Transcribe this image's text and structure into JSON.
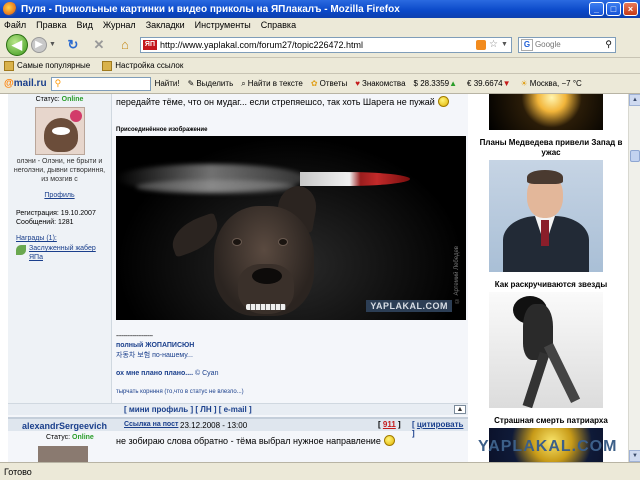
{
  "window": {
    "title": "Пуля - Прикольные картинки и видео приколы на ЯПлакалъ - Mozilla Firefox",
    "minimize": "_",
    "maximize": "□",
    "close": "×"
  },
  "menu": [
    "Файл",
    "Правка",
    "Вид",
    "Журнал",
    "Закладки",
    "Инструменты",
    "Справка"
  ],
  "nav": {
    "url": "http://www.yaplakal.com/forum27/topic226472.html",
    "site_icon_text": "ЯП",
    "search_placeholder": "Google",
    "search_engine_letter": "G"
  },
  "bookmarks": [
    "Самые популярные",
    "Настройка ссылок"
  ],
  "mailbar": {
    "logo_prefix": "@",
    "logo": "mail.ru",
    "find": "Найти!",
    "highlight": "Выделить",
    "find_in_text": "Найти в тексте",
    "answers": "Ответы",
    "dating": "Знакомства",
    "usd": "$ 28.3359",
    "eur": "€ 39.6674",
    "weather": "Москва, −7 °C"
  },
  "post1": {
    "user_status_label": "Статус:",
    "user_status_value": "Online",
    "motto": "олэни - Олэни, не брыти и неголэни, дывни створиння, из мозгив с",
    "profile_link": "Профиль",
    "registered": "Регистрация: 19.10.2007",
    "messages": "Сообщений: 1281",
    "awards_label": "Награды (1):",
    "award_name": "Заслуженный жабер ЯПа",
    "text": "передайте тёме, что он мудаг... если стрепяешсо, так хоть Шарега не пужай",
    "attached_label": "Присоединённое изображение",
    "photo_copyright": "© Артемий Лебедев",
    "photo_watermark": "YAPLAKAL.COM",
    "sig_dashes": "--------------------",
    "sig_line1": "полный ЖОПАПИСЮН",
    "sig_line2": "자동차 보험 по-нашему...",
    "sig_line3": "ох мне плано плано....",
    "sig_line3_extra": "© Cyan",
    "sig_line4": "тырчать корнння (то,что в статус не влезло...)",
    "footer_links": "[ мини профиль ] [ ЛН ] [ e-mail ]",
    "up_arrow": "▲"
  },
  "post2": {
    "author": "alexandrSergeevich",
    "post_link": "Ссылка на пост",
    "date": "23.12.2008 - 13:00",
    "number": "911",
    "cite": "цитировать",
    "status_label": "Статус:",
    "status_value": "Online",
    "text": "не зобираю слова обратно - тёма выбрал нужное направление"
  },
  "ads": {
    "title1": "Планы Медведева привели Запад в ужас",
    "title2": "Как раскручиваются звезды",
    "title3": "Страшная смерть патриарха"
  },
  "watermark": "YAPLAKAL.COM",
  "status_bar": "Готово"
}
